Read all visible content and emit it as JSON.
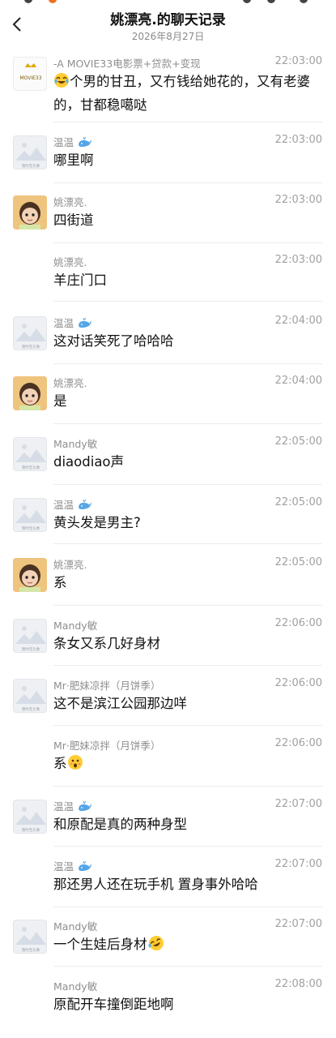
{
  "header": {
    "title": "姚漂亮.的聊天记录",
    "date": "2026年8月27日"
  },
  "avatar_labels": {
    "movie": "MOVIE33",
    "placeholder": "暂时无头像"
  },
  "messages": [
    {
      "nick": "-A MOVIE33电影票+贷款+变现",
      "time": "22:03:00",
      "pre_emoji": "laughing-tears",
      "text": "个男的甘丑，又冇钱给她花的，又有老婆的，甘都稳噶哒",
      "avatar": "movie"
    },
    {
      "nick": "温温",
      "nick_emoji": "whale",
      "time": "22:03:00",
      "text": "哪里啊",
      "avatar": "placeholder"
    },
    {
      "nick": "姚漂亮.",
      "time": "22:03:00",
      "text": "四街道",
      "avatar": "kid"
    },
    {
      "nick": "姚漂亮.",
      "time": "22:03:00",
      "text": "羊庄门口",
      "avatar": "none"
    },
    {
      "nick": "温温",
      "nick_emoji": "whale",
      "time": "22:04:00",
      "text": "这对话笑死了哈哈哈",
      "avatar": "placeholder"
    },
    {
      "nick": "姚漂亮.",
      "time": "22:04:00",
      "text": "是",
      "avatar": "kid"
    },
    {
      "nick": "Mandy敏",
      "time": "22:05:00",
      "text": "diaodiao声",
      "avatar": "placeholder"
    },
    {
      "nick": "温温",
      "nick_emoji": "whale",
      "time": "22:05:00",
      "text": "黄头发是男主?",
      "avatar": "placeholder"
    },
    {
      "nick": "姚漂亮.",
      "time": "22:05:00",
      "text": "系",
      "avatar": "kid"
    },
    {
      "nick": "Mandy敏",
      "time": "22:06:00",
      "text": "条女又系几好身材",
      "avatar": "placeholder"
    },
    {
      "nick": "Mr·肥妹凉拌（月饼季）",
      "time": "22:06:00",
      "text": "这不是滨江公园那边咩",
      "avatar": "placeholder"
    },
    {
      "nick": "Mr·肥妹凉拌（月饼季）",
      "time": "22:06:00",
      "text": "系",
      "post_emoji": "astonished",
      "avatar": "none"
    },
    {
      "nick": "温温",
      "nick_emoji": "whale",
      "time": "22:07:00",
      "text": "和原配是真的两种身型",
      "avatar": "placeholder"
    },
    {
      "nick": "温温",
      "nick_emoji": "whale",
      "time": "22:07:00",
      "text": "那还男人还在玩手机 置身事外哈哈",
      "avatar": "none"
    },
    {
      "nick": "Mandy敏",
      "time": "22:07:00",
      "text": "一个生娃后身材",
      "post_emoji": "rolling-laugh",
      "avatar": "placeholder"
    },
    {
      "nick": "Mandy敏",
      "time": "22:08:00",
      "text": "原配开车撞倒距地啊",
      "avatar": "none"
    }
  ]
}
